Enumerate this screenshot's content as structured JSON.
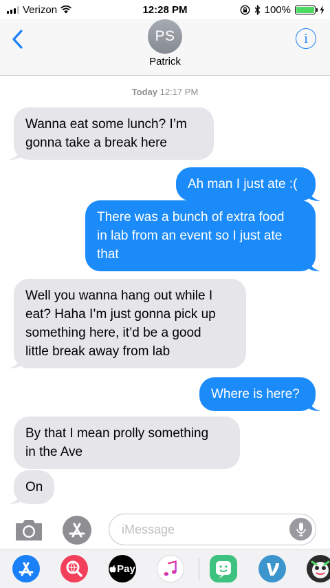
{
  "status_bar": {
    "carrier": "Verizon",
    "time": "12:28 PM",
    "battery": "100%"
  },
  "header": {
    "avatar_initials": "PS",
    "contact_name": "Patrick",
    "info_glyph": "i"
  },
  "thread": {
    "timestamp_day": "Today",
    "timestamp_time": "12:17 PM",
    "messages": [
      {
        "from": "them",
        "lines": [
          "Wanna eat some lunch? I’m",
          "gonna take a break here"
        ]
      },
      {
        "from": "me",
        "lines": [
          "Ah man I just ate :("
        ]
      },
      {
        "from": "me",
        "lines": [
          "There was a bunch of extra food",
          "in lab from an event so I just ate",
          "that"
        ]
      },
      {
        "from": "them",
        "lines": [
          "Well you wanna hang out while I",
          "eat? Haha I’m just gonna pick up",
          "something here, it’d be a good",
          "little break away from lab"
        ]
      },
      {
        "from": "me",
        "lines": [
          "Where is here?"
        ]
      },
      {
        "from": "them",
        "lines": [
          "By that I mean prolly something",
          "in the Ave"
        ]
      },
      {
        "from": "them",
        "lines": [
          "On"
        ]
      }
    ]
  },
  "input": {
    "placeholder": "iMessage"
  },
  "app_drawer": {
    "apple_pay_label": "Pay",
    "apps": [
      "app-store-icon",
      "web-images-icon",
      "apple-pay-icon",
      "music-icon",
      "bitmoji-icon",
      "venmo-icon",
      "game-icon"
    ]
  },
  "colors": {
    "outgoing_bubble": "#1b8bf9",
    "incoming_bubble": "#e5e5ea",
    "accent": "#1a80f8",
    "battery": "#4cd964"
  }
}
